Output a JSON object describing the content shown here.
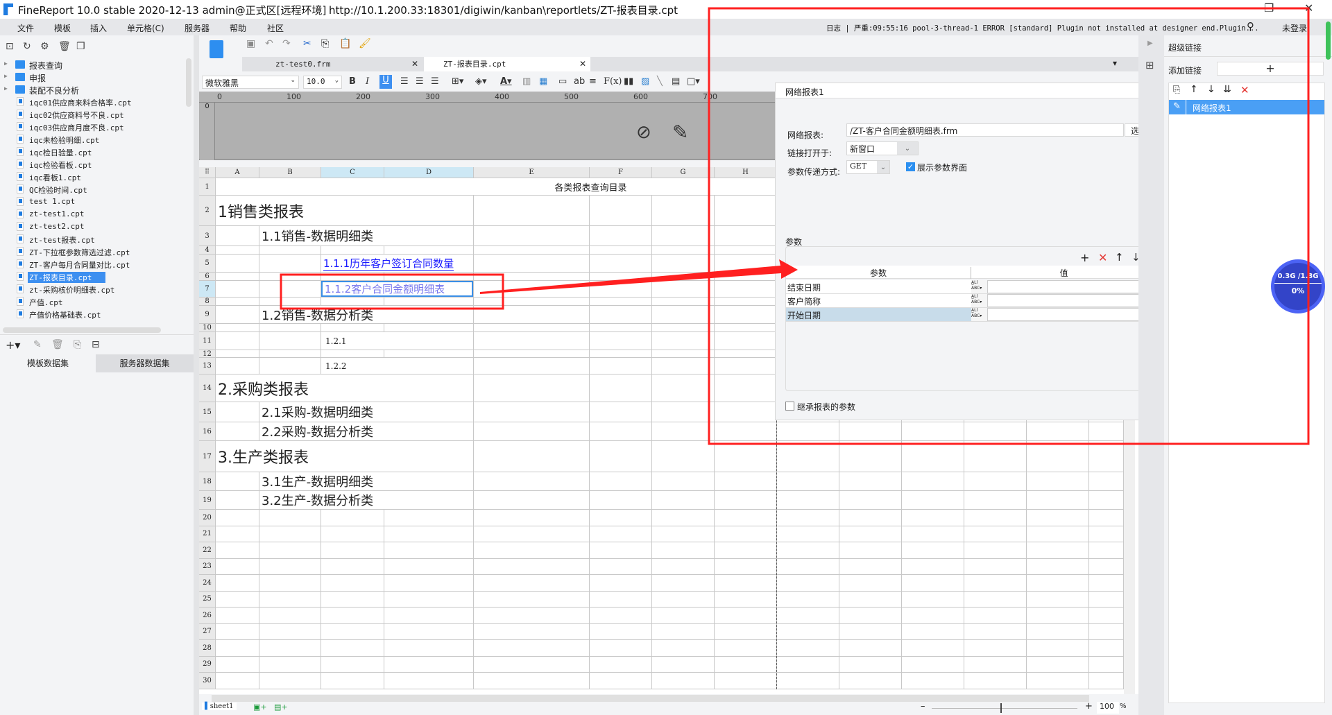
{
  "window": {
    "title": "FineReport 10.0 stable 2020-12-13 admin@正式区[远程环境]",
    "url": "http://10.1.200.33:18301/digiwin/kanban\\reportlets/ZT-报表目录.cpt",
    "minimize": "–",
    "maximize": "❐",
    "close": "✕"
  },
  "menu": {
    "items": [
      "文件",
      "模板",
      "插入",
      "单元格(C)",
      "服务器",
      "帮助",
      "社区"
    ],
    "log_label": "日志",
    "log_text": "严重:09:55:16 pool-3-thread-1 ERROR [standard] Plugin not installed at designer end.Plugin...",
    "login": "未登录"
  },
  "left": {
    "tree": [
      {
        "label": "报表查询",
        "type": "folder"
      },
      {
        "label": "申报",
        "type": "folder"
      },
      {
        "label": "装配不良分析",
        "type": "folder"
      },
      {
        "label": "iqc01供应商来料合格率.cpt",
        "type": "file"
      },
      {
        "label": "iqc02供应商料号不良.cpt",
        "type": "file"
      },
      {
        "label": "iqc03供应商月度不良.cpt",
        "type": "file"
      },
      {
        "label": "iqc未检验明细.cpt",
        "type": "file"
      },
      {
        "label": "iqc检日验量.cpt",
        "type": "file"
      },
      {
        "label": "iqc检验看板.cpt",
        "type": "file"
      },
      {
        "label": "iqc看板1.cpt",
        "type": "file"
      },
      {
        "label": "QC检验时间.cpt",
        "type": "file"
      },
      {
        "label": "test 1.cpt",
        "type": "file"
      },
      {
        "label": "zt-test1.cpt",
        "type": "file"
      },
      {
        "label": "zt-test2.cpt",
        "type": "file"
      },
      {
        "label": "zt-test报表.cpt",
        "type": "file"
      },
      {
        "label": "ZT-下拉框参数筛选过滤.cpt",
        "type": "file"
      },
      {
        "label": "ZT-客户每月合同量对比.cpt",
        "type": "file"
      },
      {
        "label": "ZT-报表目录.cpt",
        "type": "file",
        "selected": true
      },
      {
        "label": "zt-采购核价明细表.cpt",
        "type": "file"
      },
      {
        "label": "产值.cpt",
        "type": "file"
      },
      {
        "label": "产值价格基础表.cpt",
        "type": "file"
      }
    ],
    "tabs": [
      "模板数据集",
      "服务器数据集"
    ]
  },
  "editor": {
    "tabs": [
      {
        "label": "zt-test0.frm"
      },
      {
        "label": "ZT-报表目录.cpt",
        "active": true
      }
    ],
    "font": "微软雅黑",
    "font_size": "10.0",
    "ruler": [
      "0",
      "100",
      "200",
      "300",
      "400",
      "500",
      "600",
      "700"
    ],
    "columns": [
      "A",
      "B",
      "C",
      "D",
      "E",
      "F",
      "G",
      "H"
    ],
    "selected_columns": [
      "C",
      "D"
    ],
    "selected_row": 7,
    "row_count": 30,
    "cells": [
      {
        "row": 1,
        "col": "A",
        "to": "K",
        "text": "各类报表查询目录",
        "style": "title"
      },
      {
        "row": 2,
        "col": "A",
        "to": "D",
        "text": "1销售类报表",
        "style": "h1"
      },
      {
        "row": 3,
        "col": "B",
        "to": "D",
        "text": "1.1销售-数据明细类",
        "style": "h2"
      },
      {
        "row": 5,
        "col": "C",
        "to": "D",
        "text": "1.1.1历年客户签订合同数量",
        "style": "link"
      },
      {
        "row": 7,
        "col": "C",
        "to": "D",
        "text": "1.1.2客户合同金额明细表",
        "style": "link2",
        "selected": true
      },
      {
        "row": 9,
        "col": "B",
        "to": "D",
        "text": "1.2销售-数据分析类",
        "style": "h2"
      },
      {
        "row": 11,
        "col": "C",
        "to": "D",
        "text": "1.2.1",
        "style": "plain"
      },
      {
        "row": 13,
        "col": "C",
        "to": "D",
        "text": "1.2.2",
        "style": "plain"
      },
      {
        "row": 14,
        "col": "A",
        "to": "D",
        "text": "2.采购类报表",
        "style": "h1"
      },
      {
        "row": 15,
        "col": "B",
        "to": "D",
        "text": "2.1采购-数据明细类",
        "style": "h2"
      },
      {
        "row": 16,
        "col": "B",
        "to": "D",
        "text": "2.2采购-数据分析类",
        "style": "h2"
      },
      {
        "row": 17,
        "col": "A",
        "to": "D",
        "text": "3.生产类报表",
        "style": "h1"
      },
      {
        "row": 18,
        "col": "B",
        "to": "D",
        "text": "3.1生产-数据明细类",
        "style": "h2"
      },
      {
        "row": 19,
        "col": "B",
        "to": "D",
        "text": "3.2生产-数据分析类",
        "style": "h2"
      }
    ],
    "sheet": "sheet1",
    "zoom": "100",
    "zoom_unit": "%"
  },
  "dialog": {
    "title": "网络报表1",
    "report_label": "网络报表:",
    "report_value": "/ZT-客户合同金额明细表.frm",
    "select_button": "选择",
    "open_label": "链接打开于:",
    "open_value": "新窗口",
    "method_label": "参数传递方式:",
    "method_value": "GET",
    "show_params_label": "展示参数界面",
    "show_params_checked": true,
    "params_title": "参数",
    "col_param": "参数",
    "col_value": "值",
    "params": [
      {
        "name": "结束日期",
        "value": ""
      },
      {
        "name": "客户简称",
        "value": ""
      },
      {
        "name": "开始日期",
        "value": "",
        "selected": true
      }
    ],
    "inherit_label": "继承报表的参数",
    "inherit_checked": false
  },
  "hyperlink": {
    "title": "超级链接",
    "add_label": "添加链接",
    "add_button": "+",
    "items": [
      "网络报表1"
    ]
  },
  "memory": {
    "usage": "0.3G /1.3G",
    "percent": "0%"
  },
  "colors": {
    "accent": "#3d8ff0",
    "annotation": "#ff2020",
    "link": "#1a1aff",
    "memory": "#3344c8"
  }
}
